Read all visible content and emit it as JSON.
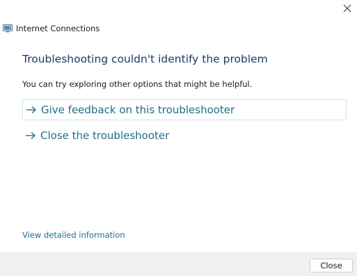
{
  "window": {
    "app_title": "Internet Connections",
    "app_icon": "network-connections-icon",
    "close_icon": "close-icon"
  },
  "main": {
    "heading": "Troubleshooting couldn't identify the problem",
    "subtext": "You can try exploring other options that might be helpful.",
    "options": [
      {
        "label": "Give feedback on this troubleshooter",
        "icon": "arrow-right-icon",
        "focused": true
      },
      {
        "label": "Close the troubleshooter",
        "icon": "arrow-right-icon",
        "focused": false
      }
    ],
    "detail_link": "View detailed information"
  },
  "footer": {
    "close_label": "Close"
  },
  "colors": {
    "heading": "#1b3a66",
    "link": "#1f6f86",
    "footer_bg": "#f0f0f0"
  }
}
